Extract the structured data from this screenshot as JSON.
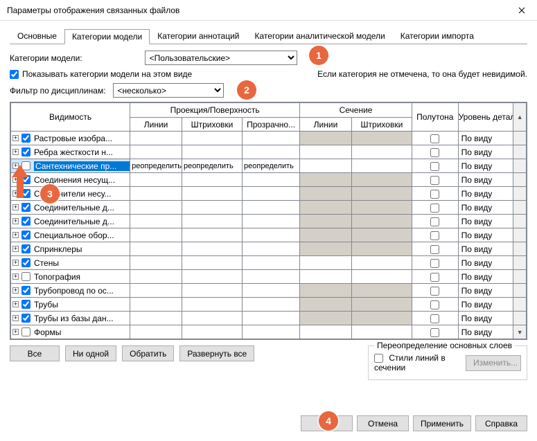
{
  "window": {
    "title": "Параметры отображения связанных файлов"
  },
  "tabs": {
    "main": "Основные",
    "model_cat": "Категории модели",
    "annot_cat": "Категории аннотаций",
    "analyt_cat": "Категории аналитической модели",
    "import_cat": "Категории импорта"
  },
  "controls": {
    "model_cat_label": "Категории модели:",
    "model_cat_value": "<Пользовательские>",
    "show_cats_label": "Показывать категории модели на этом виде",
    "invisible_hint": "Если категория не отмечена, то она будет невидимой.",
    "filter_label": "Фильтр по дисциплинам:",
    "filter_value": "<несколько>"
  },
  "headers": {
    "visibility": "Видимость",
    "projection": "Проекция/Поверхность",
    "section": "Сечение",
    "halftone": "Полутона",
    "detail": "Уровень детализ...",
    "lines": "Линии",
    "hatches": "Штриховки",
    "transparency": "Прозрачно..."
  },
  "rows": [
    {
      "exp": true,
      "chk": true,
      "name": "Растровые изобра...",
      "gray_proj": false,
      "gray_sec": true,
      "det": "По виду"
    },
    {
      "exp": true,
      "chk": true,
      "name": "Ребра жесткости н...",
      "gray_proj": false,
      "gray_sec": false,
      "det": "По виду"
    },
    {
      "exp": true,
      "chk": false,
      "name": "Сантехнические пр...",
      "selected": true,
      "override": true,
      "det": "По виду"
    },
    {
      "exp": true,
      "chk": true,
      "name": "Соединения несущ...",
      "gray_proj": false,
      "gray_sec": true,
      "det": "По виду"
    },
    {
      "exp": true,
      "chk": true,
      "name": "Соединители несу...",
      "gray_proj": false,
      "gray_sec": true,
      "det": "По виду"
    },
    {
      "exp": true,
      "chk": true,
      "name": "Соединительные д...",
      "gray_proj": false,
      "gray_sec": true,
      "det": "По виду"
    },
    {
      "exp": true,
      "chk": true,
      "name": "Соединительные д...",
      "gray_proj": false,
      "gray_sec": true,
      "det": "По виду"
    },
    {
      "exp": true,
      "chk": true,
      "name": "Специальное обор...",
      "gray_proj": false,
      "gray_sec": true,
      "det": "По виду"
    },
    {
      "exp": true,
      "chk": true,
      "name": "Спринклеры",
      "gray_proj": false,
      "gray_sec": true,
      "det": "По виду"
    },
    {
      "exp": true,
      "chk": true,
      "name": "Стены",
      "gray_proj": false,
      "gray_sec": false,
      "det": "По виду"
    },
    {
      "exp": true,
      "chk": false,
      "name": "Топография",
      "gray_proj": false,
      "gray_sec": false,
      "det": "По виду"
    },
    {
      "exp": true,
      "chk": true,
      "name": "Трубопровод по ос...",
      "gray_proj": false,
      "gray_sec": true,
      "det": "По виду"
    },
    {
      "exp": true,
      "chk": true,
      "name": "Трубы",
      "gray_proj": false,
      "gray_sec": true,
      "det": "По виду"
    },
    {
      "exp": true,
      "chk": true,
      "name": "Трубы из базы дан...",
      "gray_proj": false,
      "gray_sec": true,
      "det": "По виду"
    },
    {
      "exp": true,
      "chk": false,
      "name": "Формы",
      "gray_proj": false,
      "gray_sec": false,
      "det": "По виду"
    }
  ],
  "override_text": {
    "lines": "реопределить",
    "hatch": "реопределить",
    "trans": "реопределить"
  },
  "buttons": {
    "all": "Все",
    "none": "Ни одной",
    "invert": "Обратить",
    "expand": "Развернуть все",
    "override_legend": "Переопределение основных слоев",
    "styles_label": "Стили линий в сечении",
    "modify": "Изменить...",
    "ok": "ОК",
    "cancel": "Отмена",
    "apply": "Применить",
    "help": "Справка"
  },
  "callouts": {
    "c1": "1",
    "c2": "2",
    "c3": "3",
    "c4": "4"
  }
}
